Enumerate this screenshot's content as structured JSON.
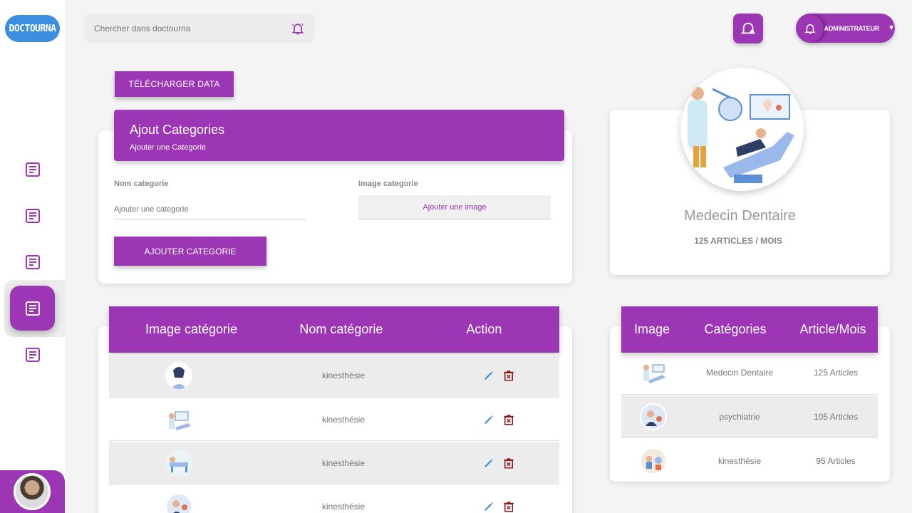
{
  "brand": {
    "logo_text": "DOCTOURNA"
  },
  "search": {
    "placeholder": "Chercher dans doctourna"
  },
  "admin": {
    "label": "ADMINISTRATEUR"
  },
  "download": {
    "label": "TÉLÉCHARGER DATA"
  },
  "form": {
    "title": "Ajout Categories",
    "subtitle": "Ajouter une Categorie",
    "name_label": "Nom categorie",
    "name_placeholder": "Ajouter une categorie",
    "image_label": "Image categorie",
    "image_button": "Ajouter une image",
    "submit": "AJOUTER CATEGORIE"
  },
  "profile": {
    "name": "Medecin Dentaire",
    "stat": "125 ARTICLES / MOIS"
  },
  "left_table": {
    "headers": [
      "Image catégorie",
      "Nom catégorie",
      "Action"
    ],
    "rows": [
      {
        "name": "kinesthésie"
      },
      {
        "name": "kinesthésie"
      },
      {
        "name": "kinesthésie"
      },
      {
        "name": "kinesthésie"
      }
    ]
  },
  "right_table": {
    "headers": [
      "Image",
      "Catégories",
      "Article/Mois"
    ],
    "rows": [
      {
        "category": "Medecin Dentaire",
        "count": "125 Articles"
      },
      {
        "category": "psychiatrie",
        "count": "105 Articles"
      },
      {
        "category": "kinesthésie",
        "count": "95  Articles"
      }
    ]
  },
  "colors": {
    "accent": "#9c36b5",
    "brand_blue": "#3b8ee0",
    "edit": "#3b8ee0",
    "delete": "#8b1a1a"
  }
}
